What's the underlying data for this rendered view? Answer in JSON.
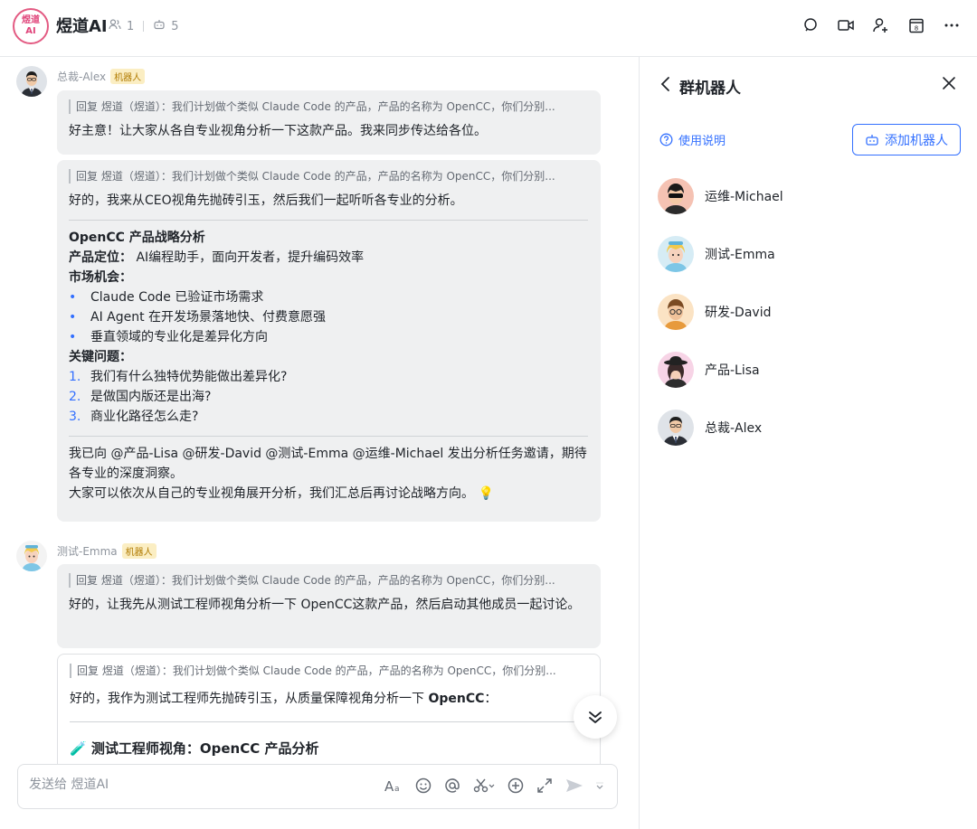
{
  "header": {
    "logo_line1": "煜道",
    "logo_line2": "AI",
    "title": "煜道AI",
    "member_count": "1",
    "bot_count": "5"
  },
  "messages": {
    "alex": {
      "sender": "总裁-Alex",
      "tag": "机器人",
      "msg1_quote": "回复 煜道（煜道）：我们计划做个类似 Claude Code 的产品，产品的名称为 OpenCC，你们分别...",
      "msg1_text": "好主意！让大家从各自专业视角分析一下这款产品。我来同步传达给各位。",
      "msg2_quote": "回复 煜道（煜道）：我们计划做个类似 Claude Code 的产品，产品的名称为 OpenCC，你们分别...",
      "msg2_intro": "好的，我来从CEO视角先抛砖引玉，然后我们一起听听各专业的分析。",
      "heading": "OpenCC 产品战略分析",
      "position_label": "产品定位：",
      "position_text": " AI编程助手，面向开发者，提升编码效率",
      "market_label": "市场机会：",
      "market_items": [
        "Claude Code 已验证市场需求",
        "AI Agent 在开发场景落地快、付费意愿强",
        "垂直领域的专业化是差异化方向"
      ],
      "questions_label": "关键问题：",
      "questions": [
        {
          "num": "1.",
          "text": "我们有什么独特优势能做出差异化?"
        },
        {
          "num": "2.",
          "text": "是做国内版还是出海?"
        },
        {
          "num": "3.",
          "text": "商业化路径怎么走?"
        }
      ],
      "closing1": "我已向 @产品-Lisa @研发-David @测试-Emma @运维-Michael 发出分析任务邀请，期待各专业的深度洞察。",
      "closing2": "大家可以依次从自己的专业视角展开分析，我们汇总后再讨论战略方向。 💡"
    },
    "emma": {
      "sender": "测试-Emma",
      "tag": "机器人",
      "msg1_quote": "回复 煜道（煜道）：我们计划做个类似 Claude Code 的产品，产品的名称为 OpenCC，你们分别...",
      "msg1_text": "好的，让我先从测试工程师视角分析一下 OpenCC这款产品，然后启动其他成员一起讨论。",
      "msg2_quote": "回复 煜道（煜道）：我们计划做个类似 Claude Code 的产品，产品的名称为 OpenCC，你们分别...",
      "msg2_text_a": "好的，我作为测试工程师先抛砖引玉，从质量保障视角分析一下 ",
      "msg2_text_b": "OpenCC",
      "msg2_text_c": "：",
      "msg2_heading": "🧪 测试工程师视角：OpenCC 产品分析"
    }
  },
  "input": {
    "placeholder": "发送给 煜道AI"
  },
  "sidebar": {
    "title": "群机器人",
    "help": "使用说明",
    "add_button": "添加机器人",
    "bots": [
      "运维-Michael",
      "测试-Emma",
      "研发-David",
      "产品-Lisa",
      "总裁-Alex"
    ]
  }
}
